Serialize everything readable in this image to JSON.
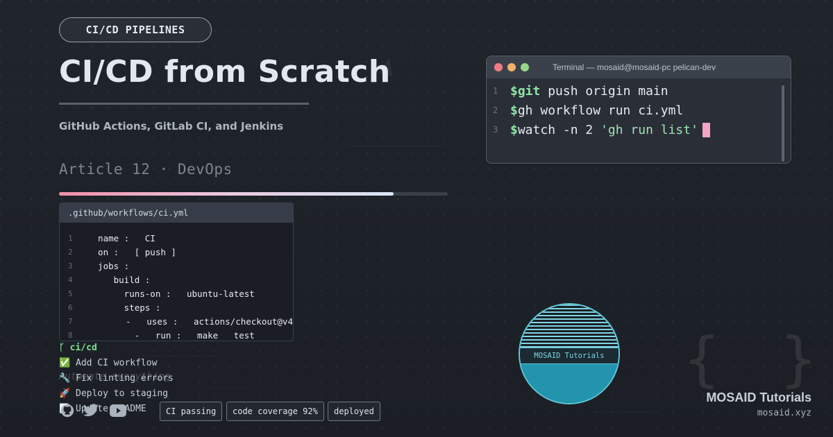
{
  "header": {
    "category_badge": "CI/CD PIPELINES",
    "title": "CI/CD from Scratch",
    "subtitle": "GitHub Actions, GitLab CI, and Jenkins",
    "article_label": "Article 12 · DevOps",
    "progress_fraction": 0.86
  },
  "editor": {
    "filename": ".github/workflows/ci.yml",
    "lines": [
      {
        "n": "1",
        "text": "  name :   CI"
      },
      {
        "n": "2",
        "text": "  on :   [ push ]"
      },
      {
        "n": "3",
        "text": "  jobs :"
      },
      {
        "n": "4",
        "text": "     build :"
      },
      {
        "n": "5",
        "text": "       runs-on :   ubuntu-latest"
      },
      {
        "n": "6",
        "text": "       steps :"
      },
      {
        "n": "7",
        "text": "         -   uses :   actions/checkout@v4"
      },
      {
        "n": "8",
        "text": "         -   run :   make   test"
      }
    ]
  },
  "git": {
    "branch": "ci/cd",
    "commits": [
      {
        "icon": "check-box-icon",
        "glyph": "✅",
        "text": "Add CI workflow"
      },
      {
        "icon": "wrench-icon",
        "glyph": "🔧",
        "text": "Fix linting errors"
      },
      {
        "icon": "rocket-icon",
        "glyph": "🚀",
        "text": "Deploy to staging"
      },
      {
        "icon": "memo-icon",
        "glyph": "📝",
        "text": "Update README"
      }
    ],
    "tagline": "Automate everything"
  },
  "status_pills": [
    "CI passing",
    "code coverage 92%",
    "deployed"
  ],
  "terminal": {
    "title": "Terminal — mosaid@mosaid-pc pelican-dev",
    "lines": [
      {
        "n": "1",
        "prompt": "$",
        "keyword": "git",
        "rest": " push origin main",
        "string": ""
      },
      {
        "n": "2",
        "prompt": "$",
        "keyword": "",
        "rest": "gh workflow run ci.yml",
        "string": ""
      },
      {
        "n": "3",
        "prompt": "$",
        "keyword": "",
        "rest": "watch -n 2 ",
        "string": "'gh run list'"
      }
    ]
  },
  "avatar": {
    "label": "MOSAID Tutorials"
  },
  "footer": {
    "brand": "MOSAID Tutorials",
    "site": "mosaid.xyz"
  },
  "colors": {
    "accent_green": "#8ee6a6",
    "cursor_pink": "#f4a4c4",
    "avatar_cyan": "#5ec8d9",
    "progress_start": "#f28fa9",
    "progress_end": "#d7e6f6"
  }
}
